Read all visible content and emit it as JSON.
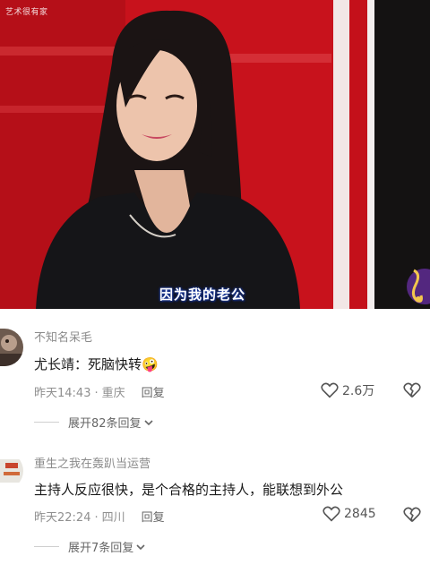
{
  "video": {
    "watermark": "艺术很有家",
    "subtitle": "因为我的老公"
  },
  "comments": [
    {
      "username": "不知名呆毛",
      "text": "尤长靖：死脑快转🤪",
      "time": "昨天14:43",
      "location": "重庆",
      "reply_label": "回复",
      "likes": "2.6万",
      "expand_label": "展开82条回复"
    },
    {
      "username": "重生之我在轰趴当运营",
      "text": "主持人反应很快，是个合格的主持人，能联想到外公",
      "time": "昨天22:24",
      "location": "四川",
      "reply_label": "回复",
      "likes": "2845",
      "expand_label": "展开7条回复"
    }
  ],
  "icons": {
    "like": "heart-outline-icon",
    "dislike": "broken-heart-icon",
    "expand": "chevron-down-icon"
  },
  "colors": {
    "background": "#ffffff",
    "username": "#8a8a8a",
    "meta": "#8f8f8f",
    "seat_red": "#c8121c"
  }
}
